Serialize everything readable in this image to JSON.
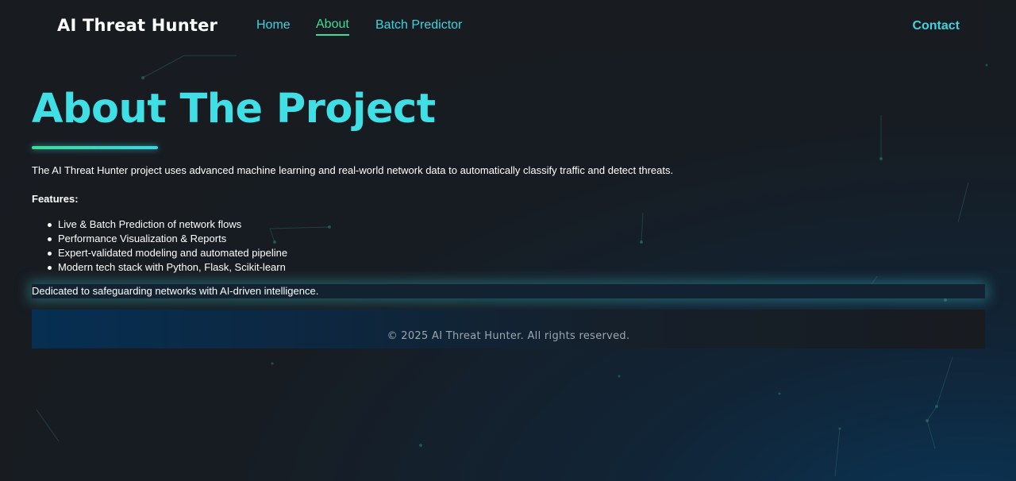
{
  "nav": {
    "brand": "AI Threat Hunter",
    "links": [
      {
        "label": "Home",
        "active": false
      },
      {
        "label": "About",
        "active": true
      },
      {
        "label": "Batch Predictor",
        "active": false
      }
    ],
    "contact": "Contact"
  },
  "main": {
    "title": "About The Project",
    "intro": "The AI Threat Hunter project uses advanced machine learning and real-world network data to automatically classify traffic and detect threats.",
    "features_label": "Features:",
    "features": [
      "Live & Batch Prediction of network flows",
      "Performance Visualization & Reports",
      "Expert-validated modeling and automated pipeline",
      "Modern tech stack with Python, Flask, Scikit-learn"
    ],
    "tagline": "Dedicated to safeguarding networks with AI-driven intelligence."
  },
  "footer": {
    "text": "© 2025 AI Threat Hunter. All rights reserved."
  },
  "colors": {
    "accent_cyan": "#40dfe6",
    "accent_green": "#3ddc97",
    "background": "#181b20"
  }
}
